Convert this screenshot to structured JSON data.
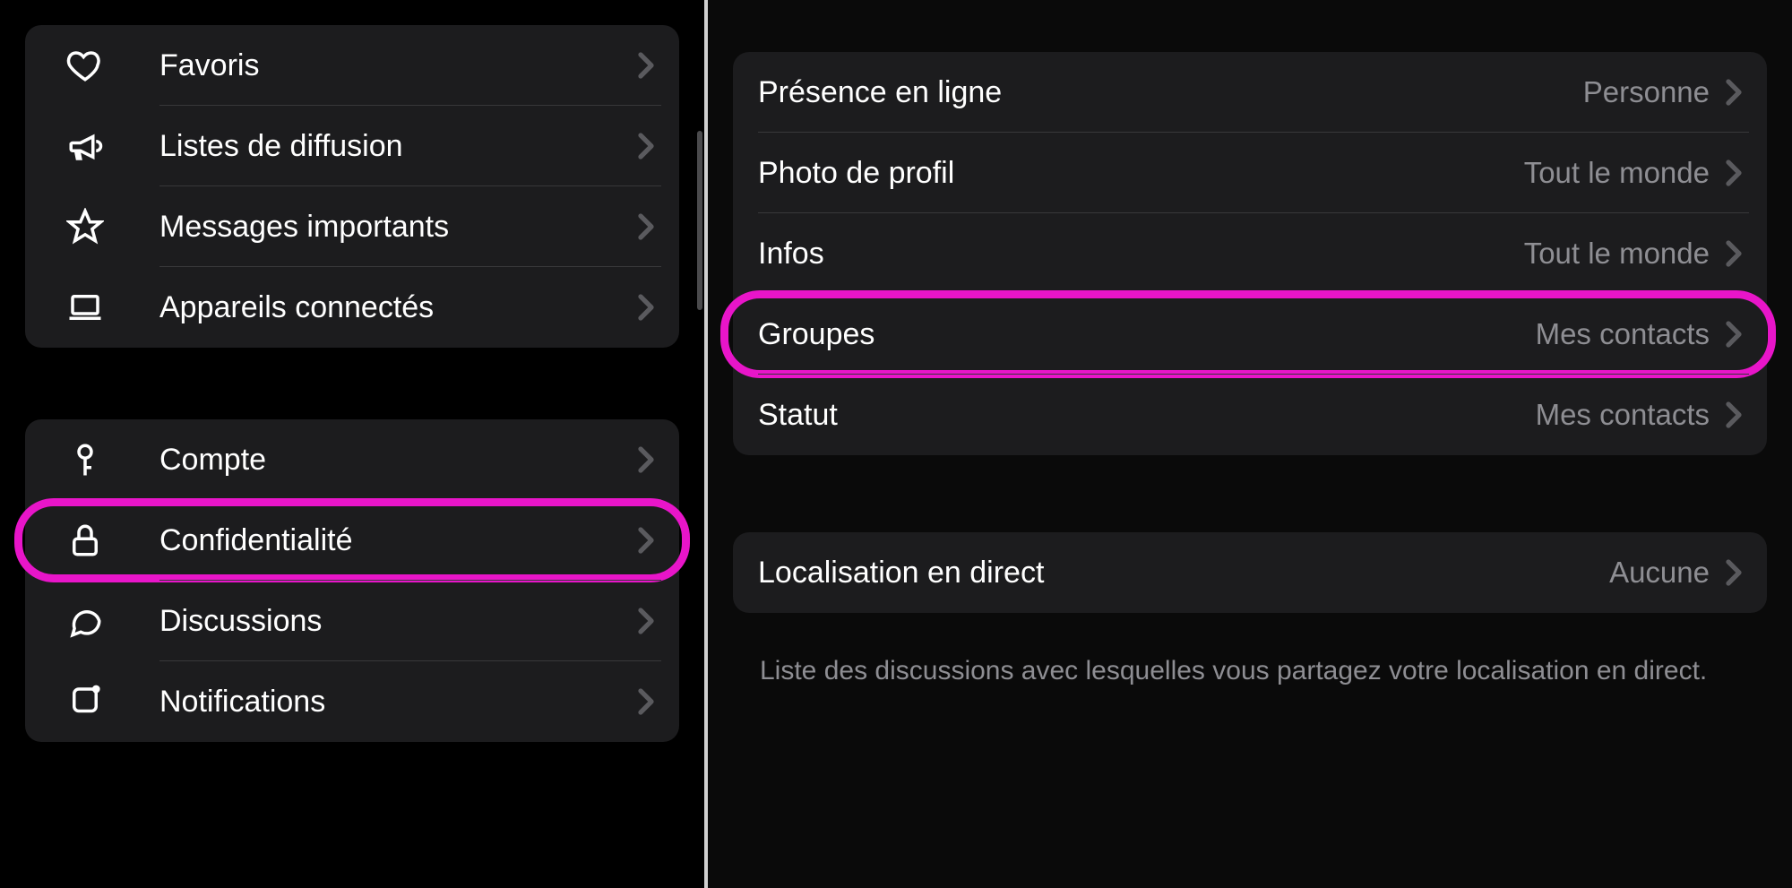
{
  "left": {
    "section1": [
      {
        "id": "favoris",
        "label": "Favoris",
        "icon": "heart"
      },
      {
        "id": "listes",
        "label": "Listes de diffusion",
        "icon": "megaphone"
      },
      {
        "id": "messages-importants",
        "label": "Messages importants",
        "icon": "star"
      },
      {
        "id": "appareils",
        "label": "Appareils connectés",
        "icon": "laptop"
      }
    ],
    "section2": [
      {
        "id": "compte",
        "label": "Compte",
        "icon": "key"
      },
      {
        "id": "confidentialite",
        "label": "Confidentialité",
        "icon": "lock",
        "highlight": true
      },
      {
        "id": "discussions",
        "label": "Discussions",
        "icon": "chat"
      },
      {
        "id": "notifications",
        "label": "Notifications",
        "icon": "notification"
      }
    ]
  },
  "right": {
    "section1": [
      {
        "id": "presence",
        "label": "Présence en ligne",
        "value": "Personne"
      },
      {
        "id": "photo-profil",
        "label": "Photo de profil",
        "value": "Tout le monde"
      },
      {
        "id": "infos",
        "label": "Infos",
        "value": "Tout le monde"
      },
      {
        "id": "groupes",
        "label": "Groupes",
        "value": "Mes contacts",
        "highlight": true
      },
      {
        "id": "statut",
        "label": "Statut",
        "value": "Mes contacts"
      }
    ],
    "section2": [
      {
        "id": "localisation",
        "label": "Localisation en direct",
        "value": "Aucune"
      }
    ],
    "footer": "Liste des discussions avec lesquelles vous partagez votre localisation en direct."
  }
}
